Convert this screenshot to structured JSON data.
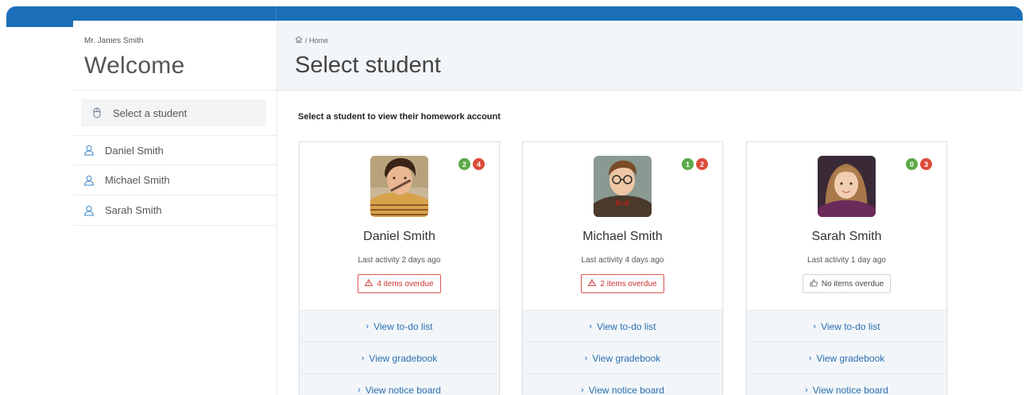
{
  "sidebar": {
    "user_name": "Mr. James Smith",
    "welcome": "Welcome",
    "select_label": "Select a student",
    "students": [
      {
        "label": "Daniel Smith"
      },
      {
        "label": "Michael Smith"
      },
      {
        "label": "Sarah Smith"
      }
    ]
  },
  "header": {
    "breadcrumb": "/ Home",
    "title": "Select student"
  },
  "main": {
    "instruction": "Select a student to view their homework account",
    "links": {
      "todo": "View to-do list",
      "gradebook": "View gradebook",
      "notice": "View notice board"
    },
    "cards": [
      {
        "name": "Daniel Smith",
        "activity": "Last activity 2 days ago",
        "badge_green": "2",
        "badge_red": "4",
        "status": "4 items overdue"
      },
      {
        "name": "Michael Smith",
        "activity": "Last activity 4 days ago",
        "badge_green": "1",
        "badge_red": "2",
        "status": "2 items overdue"
      },
      {
        "name": "Sarah Smith",
        "activity": "Last activity 1 day ago",
        "badge_green": "0",
        "badge_red": "3",
        "status": "No items overdue"
      }
    ]
  },
  "colors": {
    "topbar": "#1a6fb8",
    "link": "#2a6fb0",
    "badge_green": "#5aa946",
    "badge_red": "#dd4b39",
    "overdue": "#d9534f"
  },
  "icons": {
    "home": "home-icon",
    "mouse": "mouse-icon",
    "user": "user-icon",
    "warning": "warning-icon",
    "thumbs_up": "thumbs-up-icon",
    "chevron": "chevron-right-icon"
  }
}
